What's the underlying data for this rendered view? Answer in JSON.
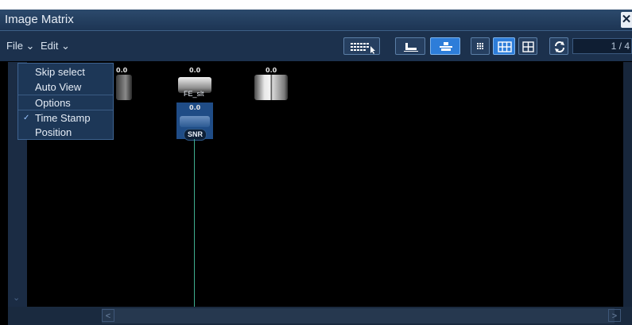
{
  "window": {
    "title": "Image Matrix",
    "close_label": "✕"
  },
  "menubar": {
    "file_label": "File ⌄",
    "edit_label": "Edit ⌄"
  },
  "toolbar": {
    "buttons": [
      {
        "name": "matrix-select-button",
        "icon": "grid-cursor-icon",
        "active": false
      },
      {
        "name": "align-bottom-button",
        "icon": "align-bottom-icon",
        "active": false
      },
      {
        "name": "align-center-button",
        "icon": "align-center-icon",
        "active": true
      },
      {
        "name": "layout-small-button",
        "icon": "grid-small-icon",
        "active": false
      },
      {
        "name": "layout-medium-button",
        "icon": "grid-medium-icon",
        "active": true
      },
      {
        "name": "layout-large-button",
        "icon": "grid-large-icon",
        "active": false
      },
      {
        "name": "refresh-button",
        "icon": "refresh-icon",
        "active": false
      }
    ],
    "page_indicator": "1 / 4"
  },
  "dropdown": {
    "items": [
      {
        "label": "Skip select",
        "checked": false
      },
      {
        "label": "Auto View",
        "checked": false
      },
      {
        "label": "Options",
        "checked": false
      },
      {
        "label": "Time Stamp",
        "checked": true
      },
      {
        "label": "Position",
        "checked": false
      }
    ],
    "check_glyph": "✓"
  },
  "matrix": {
    "cells": [
      {
        "value": "0.0",
        "label": ""
      },
      {
        "value": "0.0",
        "label": "FE_slt"
      },
      {
        "value": "0.0",
        "label": ""
      },
      {
        "value": "0.0",
        "label": "SNR"
      }
    ]
  },
  "scroll": {
    "left_arrow": "<",
    "right_arrow": ">",
    "down_arrow": "⌄",
    "up_arrow": "⌃"
  },
  "colors": {
    "accent": "#2d7dd9",
    "titlebar": "#1d3554",
    "selection": "#1f4c86",
    "cursor_line": "#3fae8f"
  }
}
